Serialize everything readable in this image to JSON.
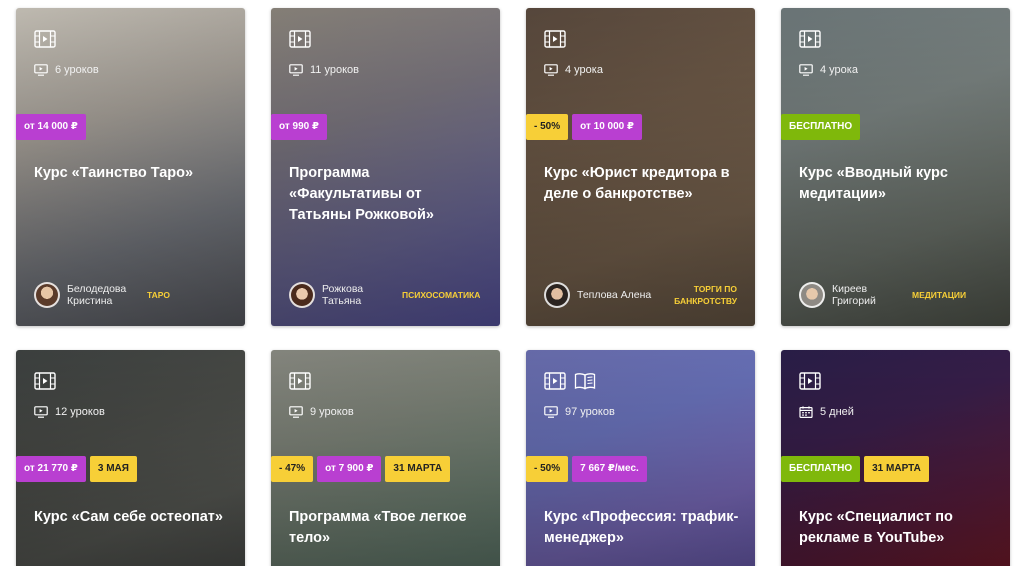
{
  "cards": [
    {
      "icons": [
        "video-icon"
      ],
      "meta_icon": "monitor-icon",
      "meta": "6 уроков",
      "badges": [
        {
          "text": "от 14 000 ₽",
          "kind": "purple"
        }
      ],
      "title": "Курс «Таинство Таро»",
      "author": "Белодедова Кристина",
      "category": "ТАРО",
      "bg": "linear-gradient(160deg,#c8c3b9 0%,#a9a39b 35%,#7a7d84 70%,#5d5f66 100%)",
      "avatar": "radial-gradient(circle at 50% 40%,#e7c6a6 0 35%,#5b3b2a 36% 100%)"
    },
    {
      "icons": [
        "video-icon"
      ],
      "meta_icon": "monitor-icon",
      "meta": "11 уроков",
      "badges": [
        {
          "text": "от 990 ₽",
          "kind": "purple"
        }
      ],
      "title": "Программа «Факультативы от Татьяны Рожковой»",
      "author": "Рожкова Татьяна",
      "category": "ПСИХОСОМАТИКА",
      "bg": "linear-gradient(160deg,#8b857c 0%,#7c7780 35%,#6d6a9a 70%,#5b57a8 100%)",
      "avatar": "radial-gradient(circle at 50% 45%,#eac9ad 0 35%,#4a2a1c 36% 100%)"
    },
    {
      "icons": [
        "video-icon"
      ],
      "meta_icon": "monitor-icon",
      "meta": "4 урока",
      "badges": [
        {
          "text": "- 50%",
          "kind": "yellow"
        },
        {
          "text": "от 10 000 ₽",
          "kind": "purple"
        }
      ],
      "title": "Курс «Юрист кредитора в деле о банкротстве»",
      "author": "Теплова Алена",
      "category": "ТОРГИ ПО БАНКРОТСТВУ",
      "bg": "linear-gradient(160deg,#5a4a3e 0%,#6e5a48 35%,#7a6550 70%,#6b5a48 100%)",
      "avatar": "radial-gradient(circle at 50% 45%,#e2bfa1 0 35%,#2b2420 36% 100%)"
    },
    {
      "icons": [
        "video-icon"
      ],
      "meta_icon": "monitor-icon",
      "meta": "4 урока",
      "badges": [
        {
          "text": "БЕСПЛАТНО",
          "kind": "green"
        }
      ],
      "title": "Курс «Вводный курс медитации»",
      "author": "Киреев Григорий",
      "category": "МЕДИТАЦИИ",
      "bg": "linear-gradient(160deg,#6f7a7c 0%,#7d8684 35%,#6f766e 70%,#54594f 100%)",
      "avatar": "radial-gradient(circle at 50% 45%,#e6c8ab 0 35%,#8e8a84 36% 100%)"
    },
    {
      "icons": [
        "video-icon"
      ],
      "meta_icon": "monitor-icon",
      "meta": "12 уроков",
      "badges": [
        {
          "text": "от 21 770 ₽",
          "kind": "purple"
        },
        {
          "text": "3 МАЯ",
          "kind": "yellow"
        }
      ],
      "title": "Курс «Сам себе остеопат»",
      "bg": "linear-gradient(160deg,#3e4241 0%,#4a4c48 35%,#585a55 70%,#4b4d4a 100%)"
    },
    {
      "icons": [
        "video-icon"
      ],
      "meta_icon": "monitor-icon",
      "meta": "9 уроков",
      "badges": [
        {
          "text": "- 47%",
          "kind": "yellow"
        },
        {
          "text": "от 7 900 ₽",
          "kind": "purple"
        },
        {
          "text": "31 МАРТА",
          "kind": "yellow"
        }
      ],
      "title": "Программа «Твое легкое тело»",
      "bg": "linear-gradient(160deg,#8a8b83 0%,#7f857a 35%,#6e8072 70%,#5d786a 100%)"
    },
    {
      "icons": [
        "video-icon",
        "book-icon"
      ],
      "meta_icon": "monitor-icon",
      "meta": "97 уроков",
      "badges": [
        {
          "text": "- 50%",
          "kind": "yellow"
        },
        {
          "text": "7 667 ₽/мес.",
          "kind": "purple"
        }
      ],
      "title": "Курс «Профессия: трафик-менеджер»",
      "bg": "linear-gradient(160deg,#6b6fb0 0%,#6b74be 35%,#7c6cbe 70%,#6a5cb0 100%)"
    },
    {
      "icons": [
        "video-icon"
      ],
      "meta_icon": "calendar-icon",
      "meta": "5 дней",
      "badges": [
        {
          "text": "БЕСПЛАТНО",
          "kind": "green"
        },
        {
          "text": "31 МАРТА",
          "kind": "yellow"
        }
      ],
      "title": "Курс «Специалист по рекламе в YouTube»",
      "bg": "linear-gradient(160deg,#2a1f4a 0%,#3a1f4c 35%,#5a1c3c 70%,#7a1b28 100%)"
    }
  ]
}
